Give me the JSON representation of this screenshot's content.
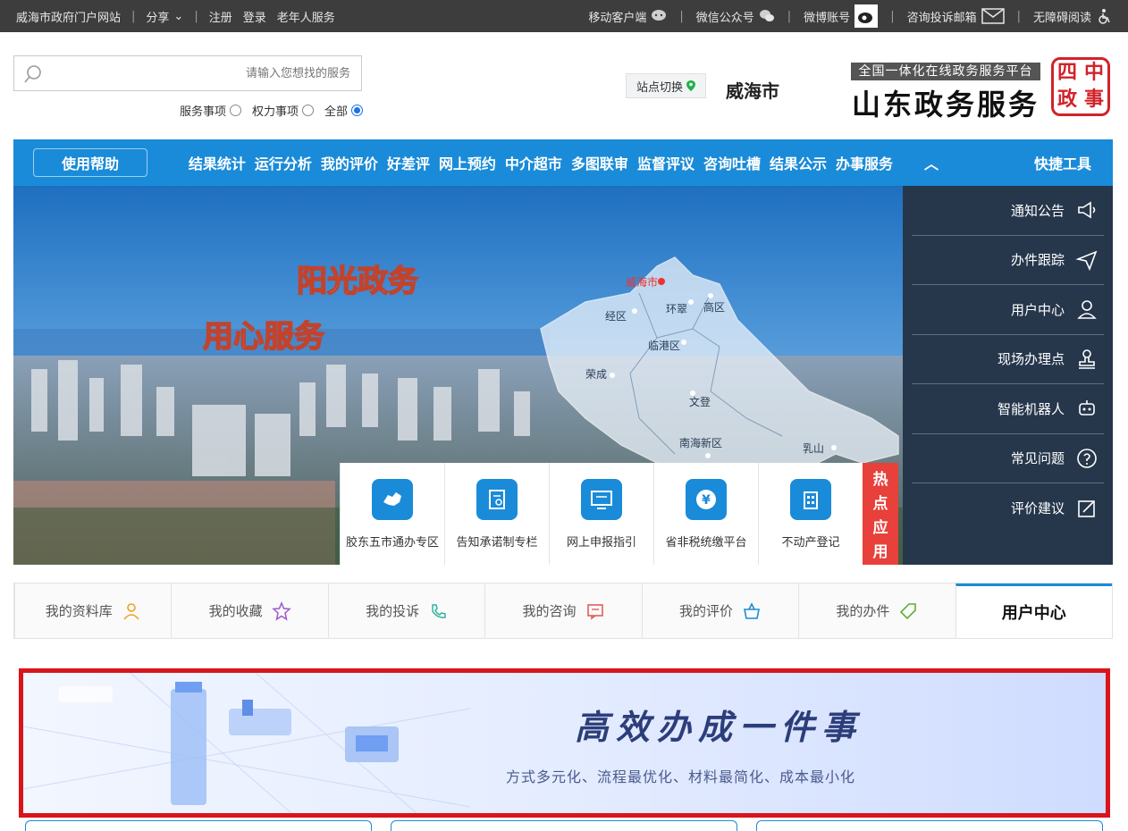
{
  "topbar": {
    "right": [
      "移动客户端",
      "微信公众号",
      "微博账号",
      "咨询投诉邮箱",
      "无障碍阅读"
    ],
    "left": [
      "老年人服务",
      "登录",
      "注册",
      "分享",
      "威海市政府门户网站"
    ]
  },
  "header": {
    "seal_chars": [
      "四",
      "中",
      "政",
      "事"
    ],
    "slogan": "全国一体化在线政务服务平台",
    "site_title": "山东政务服务",
    "city": "威海市",
    "station_switch": "站点切换",
    "search_placeholder": "请输入您想找的服务",
    "radios": [
      {
        "label": "全部",
        "checked": true
      },
      {
        "label": "权力事项",
        "checked": false
      },
      {
        "label": "服务事项",
        "checked": false
      }
    ]
  },
  "nav": {
    "items": [
      "办事服务",
      "结果公示",
      "咨询吐槽",
      "监督评议",
      "多图联审",
      "中介超市",
      "网上预约",
      "好差评",
      "我的评价",
      "运行分析",
      "结果统计"
    ],
    "help_button": "使用帮助"
  },
  "banner": {
    "slogan_1": "阳光政务",
    "slogan_2": "用心服务",
    "map_labels": [
      "威海市",
      "环翠",
      "经区",
      "高区",
      "临港区",
      "荣成",
      "文登",
      "南海新区",
      "乳山"
    ]
  },
  "quick_tools": {
    "title": "快捷工具",
    "items": [
      {
        "label": "通知公告",
        "icon": "megaphone-icon"
      },
      {
        "label": "办件跟踪",
        "icon": "paper-plane-icon"
      },
      {
        "label": "用户中心",
        "icon": "user-icon"
      },
      {
        "label": "现场办理点",
        "icon": "stamp-icon"
      },
      {
        "label": "智能机器人",
        "icon": "robot-icon"
      },
      {
        "label": "常见问题",
        "icon": "question-icon"
      },
      {
        "label": "评价建议",
        "icon": "edit-icon"
      }
    ]
  },
  "hot_apps": {
    "label_chars": [
      "热",
      "点",
      "应",
      "用"
    ],
    "items": [
      {
        "label": "不动产登记",
        "icon": "building-icon"
      },
      {
        "label": "省非税统缴平台",
        "icon": "yuan-coin-icon"
      },
      {
        "label": "网上申报指引",
        "icon": "monitor-icon"
      },
      {
        "label": "告知承诺制专栏",
        "icon": "document-stamp-icon"
      },
      {
        "label": "胶东五市通办专区",
        "icon": "region-map-icon"
      }
    ]
  },
  "user_tabs": {
    "items": [
      {
        "label": "用户中心",
        "active": true
      },
      {
        "label": "我的办件",
        "icon": "tag-icon"
      },
      {
        "label": "我的评价",
        "icon": "thumbs-icon"
      },
      {
        "label": "我的咨询",
        "icon": "message-icon"
      },
      {
        "label": "我的投诉",
        "icon": "phone-icon"
      },
      {
        "label": "我的收藏",
        "icon": "star-icon"
      },
      {
        "label": "我的资料库",
        "icon": "profile-icon"
      }
    ]
  },
  "promo": {
    "title": "高效办成一件事",
    "subtitle": "方式多元化、流程最优化、材料最简化、成本最小化"
  },
  "colors": {
    "primary": "#1a8bd8",
    "topbar": "#3d3d3d",
    "hot": "#e8403a",
    "promo_border": "#d9141b"
  }
}
